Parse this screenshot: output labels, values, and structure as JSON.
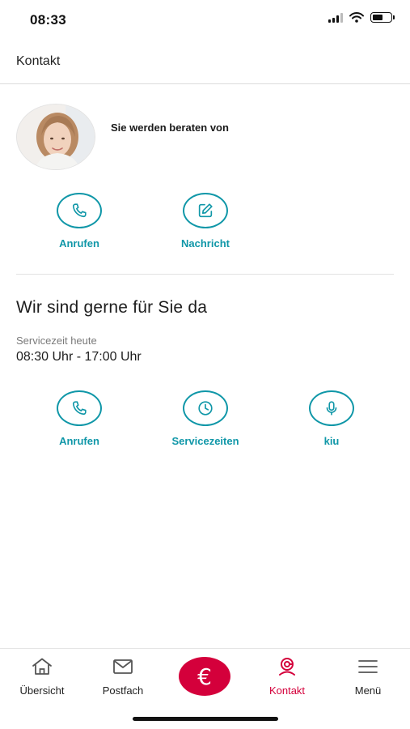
{
  "status_bar": {
    "time": "08:33",
    "battery_level": 0.55
  },
  "header": {
    "title": "Kontakt"
  },
  "advisor": {
    "label": "Sie werden beraten von",
    "actions": [
      {
        "label": "Anrufen",
        "icon": "phone-icon"
      },
      {
        "label": "Nachricht",
        "icon": "edit-message-icon"
      }
    ]
  },
  "service": {
    "title": "Wir sind gerne für Sie da",
    "hours_label": "Servicezeit heute",
    "hours_value": "08:30 Uhr - 17:00 Uhr",
    "actions": [
      {
        "label": "Anrufen",
        "icon": "phone-icon"
      },
      {
        "label": "Servicezeiten",
        "icon": "clock-icon"
      },
      {
        "label": "kiu",
        "icon": "microphone-icon"
      }
    ]
  },
  "tabbar": {
    "items": [
      {
        "label": "Übersicht",
        "icon": "home-icon"
      },
      {
        "label": "Postfach",
        "icon": "mail-icon"
      },
      {
        "label": "€",
        "icon": "euro-icon"
      },
      {
        "label": "Kontakt",
        "icon": "contact-icon",
        "active": true
      },
      {
        "label": "Menü",
        "icon": "menu-icon"
      }
    ]
  },
  "colors": {
    "accent": "#1097a8",
    "brand": "#d4003b",
    "divider": "#dcdcdc"
  }
}
